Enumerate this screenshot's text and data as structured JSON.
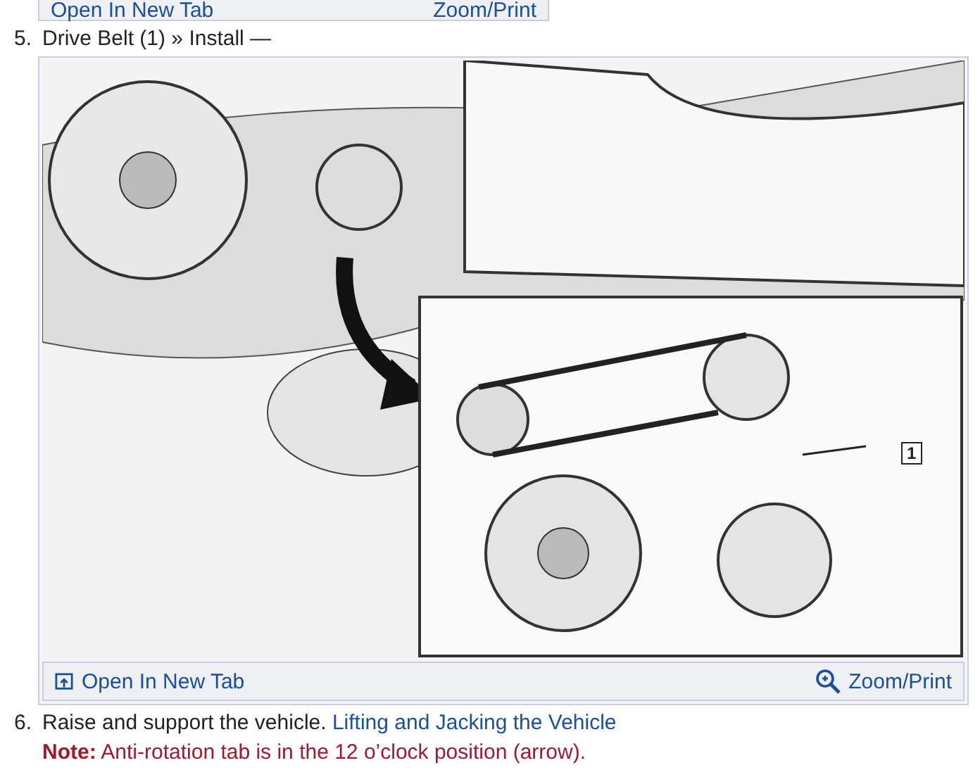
{
  "top_toolbar": {
    "open_link": "Open In New Tab",
    "zoom_link": "Zoom/Print"
  },
  "steps": [
    {
      "kind": "figure",
      "number": "5.",
      "title": "Drive Belt (1) » Install —",
      "figure": {
        "callout": "1",
        "open_link": "Open In New Tab",
        "zoom_link": "Zoom/Print"
      }
    },
    {
      "kind": "text",
      "number": "6.",
      "text": "Raise and support the vehicle.",
      "link": "Lifting and Jacking the Vehicle",
      "note": "**Note:** Anti-rotation tab is in the 12 o’clock position (arrow)."
    }
  ]
}
